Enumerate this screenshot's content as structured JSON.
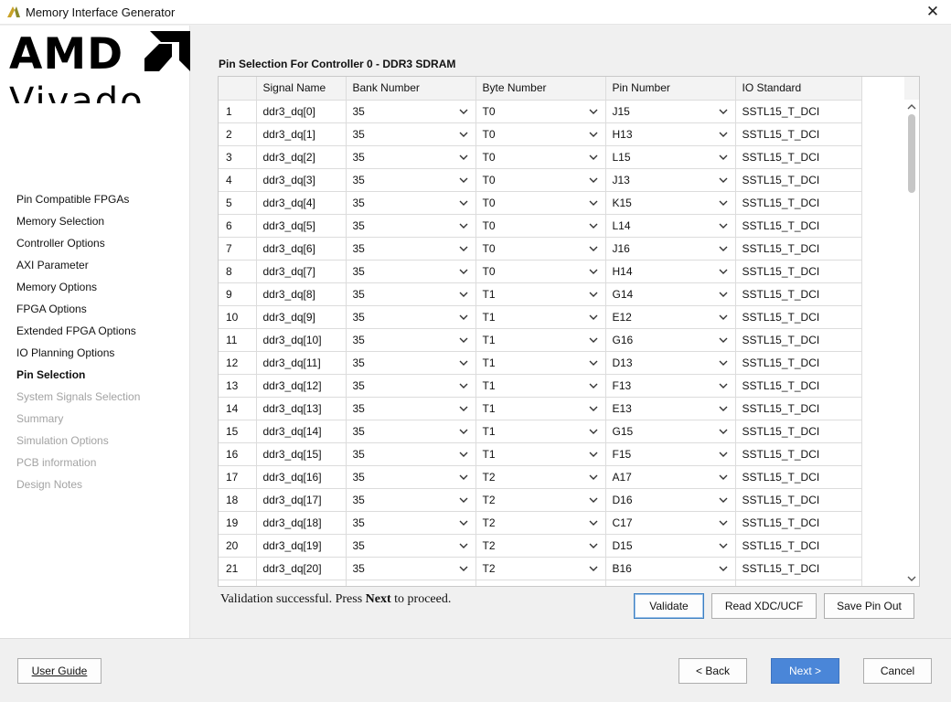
{
  "window": {
    "title": "Memory Interface Generator",
    "close_glyph": "✕",
    "app_icon": "vivado-logo-icon"
  },
  "logo": {
    "brand": "AMD",
    "product": "Vivado"
  },
  "steps": [
    {
      "label": "Pin Compatible FPGAs",
      "state": "done"
    },
    {
      "label": "Memory Selection",
      "state": "done"
    },
    {
      "label": "Controller Options",
      "state": "done"
    },
    {
      "label": "AXI Parameter",
      "state": "done"
    },
    {
      "label": "Memory Options",
      "state": "done"
    },
    {
      "label": "FPGA Options",
      "state": "done"
    },
    {
      "label": "Extended FPGA Options",
      "state": "done"
    },
    {
      "label": "IO Planning Options",
      "state": "done"
    },
    {
      "label": "Pin Selection",
      "state": "active"
    },
    {
      "label": "System Signals Selection",
      "state": "disabled"
    },
    {
      "label": "Summary",
      "state": "disabled"
    },
    {
      "label": "Simulation Options",
      "state": "disabled"
    },
    {
      "label": "PCB information",
      "state": "disabled"
    },
    {
      "label": "Design Notes",
      "state": "disabled"
    }
  ],
  "main": {
    "section_title": "Pin Selection For Controller 0 - DDR3 SDRAM",
    "columns": [
      "",
      "Signal Name",
      "Bank Number",
      "Byte Number",
      "Pin Number",
      "IO Standard"
    ],
    "rows": [
      {
        "n": "1",
        "signal": "ddr3_dq[0]",
        "bank": "35",
        "byte": "T0",
        "pin": "J15",
        "io": "SSTL15_T_DCI"
      },
      {
        "n": "2",
        "signal": "ddr3_dq[1]",
        "bank": "35",
        "byte": "T0",
        "pin": "H13",
        "io": "SSTL15_T_DCI"
      },
      {
        "n": "3",
        "signal": "ddr3_dq[2]",
        "bank": "35",
        "byte": "T0",
        "pin": "L15",
        "io": "SSTL15_T_DCI"
      },
      {
        "n": "4",
        "signal": "ddr3_dq[3]",
        "bank": "35",
        "byte": "T0",
        "pin": "J13",
        "io": "SSTL15_T_DCI"
      },
      {
        "n": "5",
        "signal": "ddr3_dq[4]",
        "bank": "35",
        "byte": "T0",
        "pin": "K15",
        "io": "SSTL15_T_DCI"
      },
      {
        "n": "6",
        "signal": "ddr3_dq[5]",
        "bank": "35",
        "byte": "T0",
        "pin": "L14",
        "io": "SSTL15_T_DCI"
      },
      {
        "n": "7",
        "signal": "ddr3_dq[6]",
        "bank": "35",
        "byte": "T0",
        "pin": "J16",
        "io": "SSTL15_T_DCI"
      },
      {
        "n": "8",
        "signal": "ddr3_dq[7]",
        "bank": "35",
        "byte": "T0",
        "pin": "H14",
        "io": "SSTL15_T_DCI"
      },
      {
        "n": "9",
        "signal": "ddr3_dq[8]",
        "bank": "35",
        "byte": "T1",
        "pin": "G14",
        "io": "SSTL15_T_DCI"
      },
      {
        "n": "10",
        "signal": "ddr3_dq[9]",
        "bank": "35",
        "byte": "T1",
        "pin": "E12",
        "io": "SSTL15_T_DCI"
      },
      {
        "n": "11",
        "signal": "ddr3_dq[10]",
        "bank": "35",
        "byte": "T1",
        "pin": "G16",
        "io": "SSTL15_T_DCI"
      },
      {
        "n": "12",
        "signal": "ddr3_dq[11]",
        "bank": "35",
        "byte": "T1",
        "pin": "D13",
        "io": "SSTL15_T_DCI"
      },
      {
        "n": "13",
        "signal": "ddr3_dq[12]",
        "bank": "35",
        "byte": "T1",
        "pin": "F13",
        "io": "SSTL15_T_DCI"
      },
      {
        "n": "14",
        "signal": "ddr3_dq[13]",
        "bank": "35",
        "byte": "T1",
        "pin": "E13",
        "io": "SSTL15_T_DCI"
      },
      {
        "n": "15",
        "signal": "ddr3_dq[14]",
        "bank": "35",
        "byte": "T1",
        "pin": "G15",
        "io": "SSTL15_T_DCI"
      },
      {
        "n": "16",
        "signal": "ddr3_dq[15]",
        "bank": "35",
        "byte": "T1",
        "pin": "F15",
        "io": "SSTL15_T_DCI"
      },
      {
        "n": "17",
        "signal": "ddr3_dq[16]",
        "bank": "35",
        "byte": "T2",
        "pin": "A17",
        "io": "SSTL15_T_DCI"
      },
      {
        "n": "18",
        "signal": "ddr3_dq[17]",
        "bank": "35",
        "byte": "T2",
        "pin": "D16",
        "io": "SSTL15_T_DCI"
      },
      {
        "n": "19",
        "signal": "ddr3_dq[18]",
        "bank": "35",
        "byte": "T2",
        "pin": "C17",
        "io": "SSTL15_T_DCI"
      },
      {
        "n": "20",
        "signal": "ddr3_dq[19]",
        "bank": "35",
        "byte": "T2",
        "pin": "D15",
        "io": "SSTL15_T_DCI"
      },
      {
        "n": "21",
        "signal": "ddr3_dq[20]",
        "bank": "35",
        "byte": "T2",
        "pin": "B16",
        "io": "SSTL15_T_DCI"
      }
    ],
    "status": {
      "prefix": "Validation successful. Press ",
      "emphasis": "Next",
      "suffix": " to proceed."
    },
    "buttons": {
      "validate": "Validate",
      "read_xdc": "Read XDC/UCF",
      "save_pin_out": "Save Pin Out"
    }
  },
  "footer": {
    "user_guide": "User Guide",
    "back": "< Back",
    "next": "Next >",
    "cancel": "Cancel"
  },
  "colors": {
    "primary_button": "#4a86d8",
    "focus_border": "#3c7fc1",
    "disabled_text": "#a3a3a3"
  }
}
